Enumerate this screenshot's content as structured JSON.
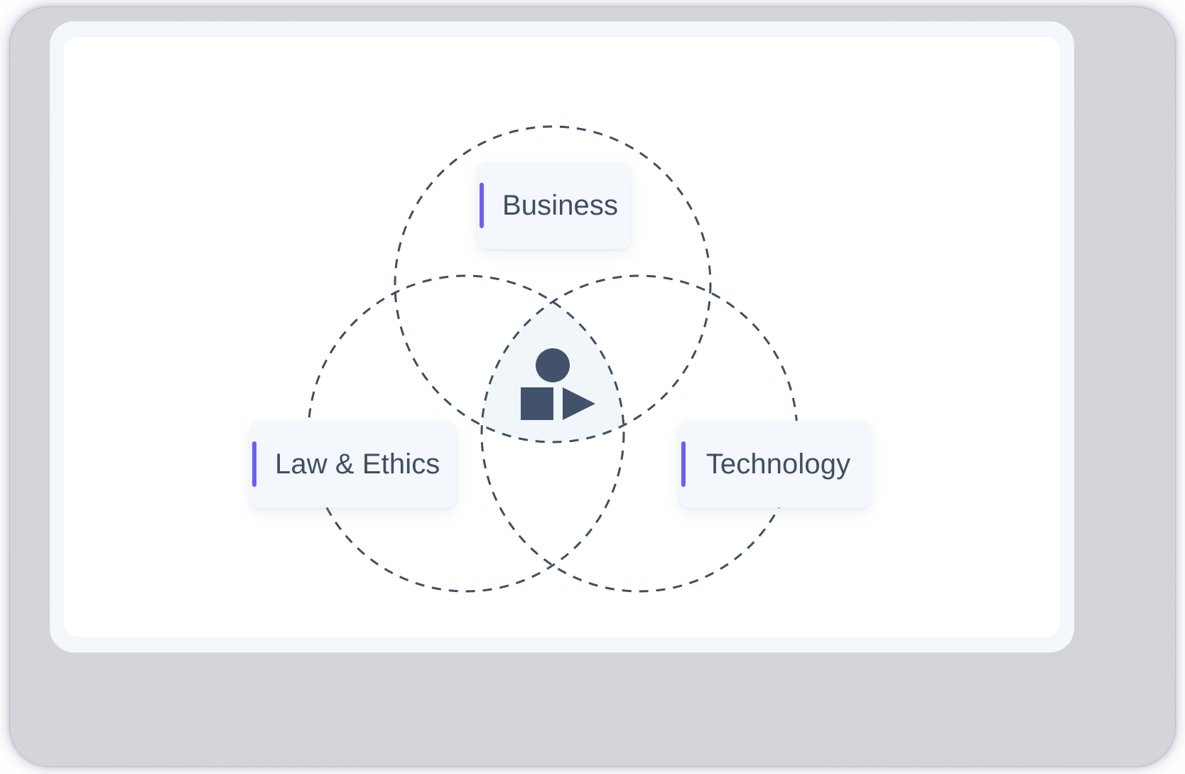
{
  "diagram": {
    "type": "venn",
    "set_count": 3,
    "title": "",
    "background_color": "#ffffff",
    "frame_color": "#f4f7fb",
    "bezel_color": "#d3d4da",
    "circle_stroke_color": "#3f4f63",
    "circle_stroke_style": "dashed",
    "circle_stroke_width": 3,
    "intersection_fill_color": "#f1f6fb",
    "sets": [
      {
        "id": "business",
        "label": "Business",
        "position": "top",
        "accent_color": "#6d5dfc",
        "card_background": "#f4f7fb",
        "text_color": "#3f4f63"
      },
      {
        "id": "law-ethics",
        "label": "Law & Ethics",
        "position": "bottom-left",
        "accent_color": "#6d5dfc",
        "card_background": "#f4f7fb",
        "text_color": "#3f4f63"
      },
      {
        "id": "technology",
        "label": "Technology",
        "position": "bottom-right",
        "accent_color": "#6d5dfc",
        "card_background": "#f4f7fb",
        "text_color": "#3f4f63"
      }
    ],
    "center": {
      "label": "",
      "icons": [
        "circle-shape-icon",
        "square-shape-icon",
        "triangle-shape-icon"
      ],
      "icon_color": "#42526b"
    }
  }
}
